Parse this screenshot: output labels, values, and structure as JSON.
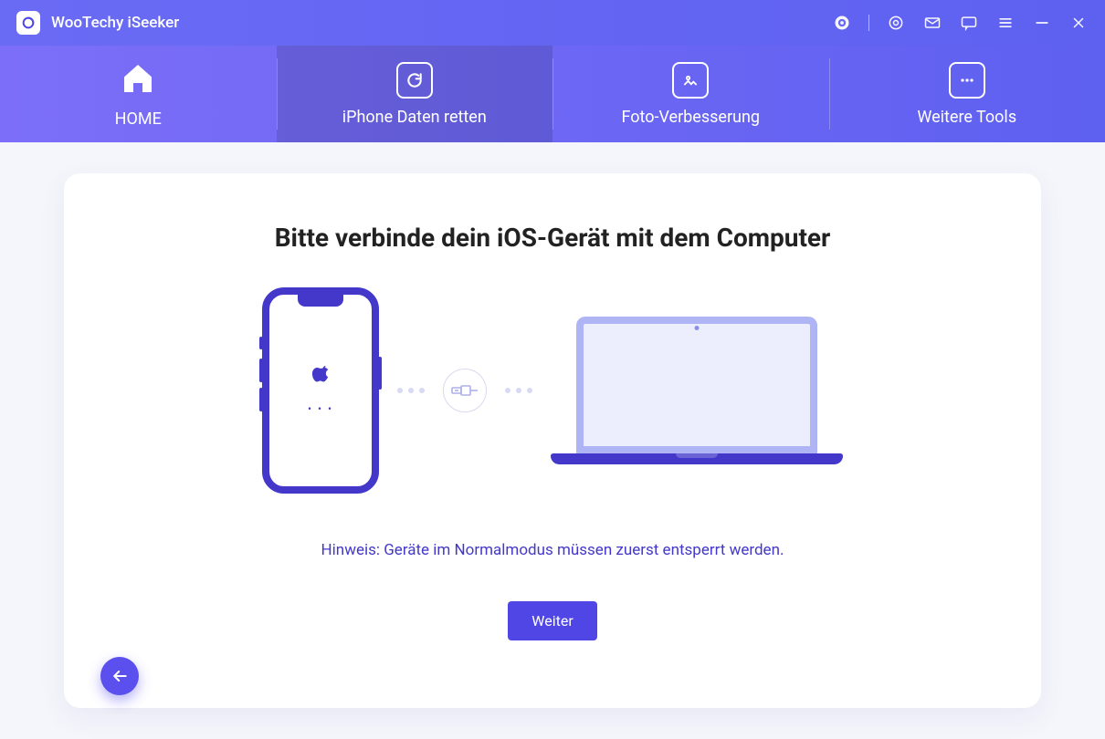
{
  "app": {
    "title": "WooTechy iSeeker"
  },
  "window_controls": {
    "support_icon": "support-icon",
    "settings_icon": "gear-icon",
    "mail_icon": "mail-icon",
    "feedback_icon": "speech-bubble-icon",
    "menu_icon": "menu-icon",
    "minimize_icon": "minimize-icon",
    "close_icon": "close-icon"
  },
  "tabs": [
    {
      "id": "home",
      "label": "HOME",
      "icon": "home-icon",
      "active": false
    },
    {
      "id": "recover",
      "label": "iPhone Daten retten",
      "icon": "refresh-icon",
      "active": true
    },
    {
      "id": "photo",
      "label": "Foto-Verbesserung",
      "icon": "image-icon",
      "active": false
    },
    {
      "id": "more",
      "label": "Weitere Tools",
      "icon": "more-icon",
      "active": false
    }
  ],
  "main": {
    "heading": "Bitte verbinde dein iOS-Gerät mit dem Computer",
    "hint": "Hinweis: Geräte im Normalmodus müssen zuerst entsperrt werden.",
    "next_label": "Weiter"
  },
  "illustration": {
    "phone_icon": "apple-logo-icon",
    "connector_icon": "usb-cable-icon",
    "device_right": "laptop-icon"
  }
}
